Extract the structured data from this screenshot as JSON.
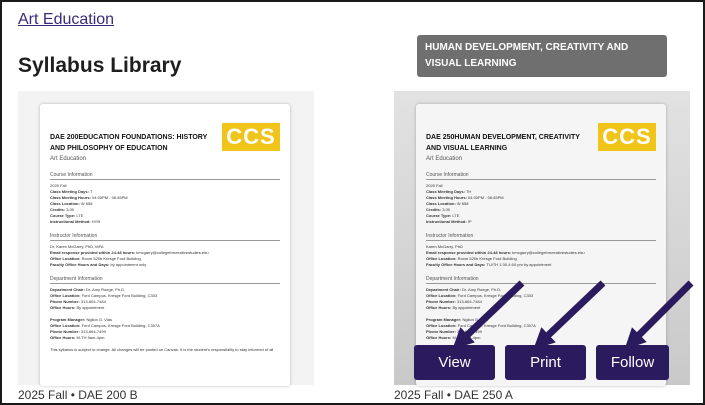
{
  "breadcrumb": "Art Education",
  "page_title": "Syllabus Library",
  "tooltip": "HUMAN DEVELOPMENT, CREATIVITY AND VISUAL LEARNING",
  "logo_text": "CCS",
  "colors": {
    "button_bg": "#2a1a5e",
    "logo": "#f0c419",
    "tooltip_bg": "#6f6f6f",
    "link": "#3b2a7a"
  },
  "cards": [
    {
      "doc_title": "DAE 200EDUCATION FOUNDATIONS: HISTORY AND PHILOSOPHY OF EDUCATION",
      "department": "Art Education",
      "sections": {
        "course": "Course Information",
        "instructor": "Instructor Information",
        "department": "Department Information"
      },
      "course_lines": [
        "2025 Fall",
        "Class Meeting Days: T",
        "Class Meeting Hours: 04:00PM - 06:45PM",
        "Class Location: W 658",
        "Credits: 3.00",
        "Course Type: LTE",
        "Instructional Method: HYB"
      ],
      "instructor_lines": [
        "Dr. Karen McGarry, PhD, MFA",
        "Email response provided within 24-48 hours: kmcgarry@collegeforcreativestudies.edu",
        "Office Location: Room 520b Kresge Ford Building",
        "Faculty Office Hours and Days: by appointment only"
      ],
      "department_lines": [
        "Department Chair: Dr. Amy Roege, Ph.D.",
        "Office Location: Ford Campus, Kresge Ford Building, C303",
        "Phone Number: 313-664-7484",
        "Office Hours: By appointment",
        "",
        "Program Manager: Ngllon G. Vias",
        "Office Location: Ford Campus, Kresge Ford Building, C307A",
        "Phone Number: 313-664-7499",
        "Office Hours: M-TH 9am-4pm",
        "",
        "This syllabus is subject to change. All changes will be posted on Canvas. It is the student's responsibility to stay informed of all"
      ],
      "caption": "2025 Fall • DAE 200 B"
    },
    {
      "doc_title": "DAE 250HUMAN DEVELOPMENT, CREATIVITY AND VISUAL LEARNING",
      "department": "Art Education",
      "sections": {
        "course": "Course Information",
        "instructor": "Instructor Information",
        "department": "Department Information"
      },
      "course_lines": [
        "2025 Fall",
        "Class Meeting Days: TH",
        "Class Meeting Hours: 04:00PM - 06:45PM",
        "Class Location: W 658",
        "Credits: 3.00",
        "Course Type: LTE",
        "Instructional Method: IP"
      ],
      "instructor_lines": [
        "Karen McGarry, PhD",
        "Email response provided within 24-48 hours: kmcgarry@collegeforcreativestudies.edu",
        "Office Location: Room 520b Kresge Ford Building",
        "Faculty Office Hours and Days: TU/TH 1:30-4:00 pm by appointment"
      ],
      "department_lines": [
        "Department Chair: Dr. Amy Roege, Ph.D.",
        "Office Location: Ford Campus, Kresge Ford Building, C303",
        "Phone Number: 313-664-7484",
        "Office Hours: By appointment",
        "",
        "Program Manager: Ngllon G. Vias",
        "Office Location: Ford Campus, Kresge Ford Building, C307A",
        "Phone Number: 313-664-7499",
        "Office Hours: M-TH 9am-4pm"
      ],
      "caption": "2025 Fall • DAE 250 A"
    }
  ],
  "buttons": {
    "view": "View",
    "print": "Print",
    "follow": "Follow"
  }
}
